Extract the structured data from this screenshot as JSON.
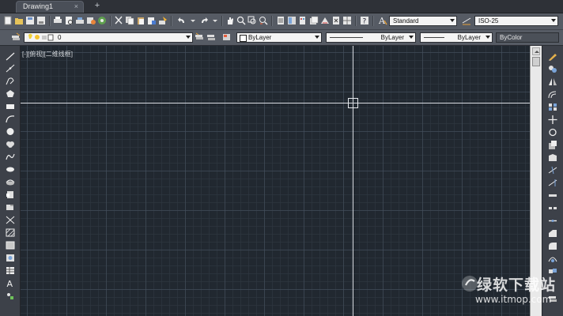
{
  "tab": {
    "title": "Drawing1",
    "close": "×",
    "new": "+"
  },
  "toolbar": {
    "text_style": "Standard",
    "dim_style": "ISO-25"
  },
  "properties_bar": {
    "layer": "0",
    "color": "ByLayer",
    "linetype": "ByLayer",
    "lineweight": "ByLayer",
    "plotstyle": "ByColor"
  },
  "viewport": {
    "label": "[-][俯视][二维线框]"
  },
  "watermark": {
    "title": "绿软下载站",
    "url": "www.itmop.com"
  },
  "colors": {
    "canvas": "#212830",
    "crosshair": "#d9dde3",
    "toolbar": "#565b64"
  }
}
